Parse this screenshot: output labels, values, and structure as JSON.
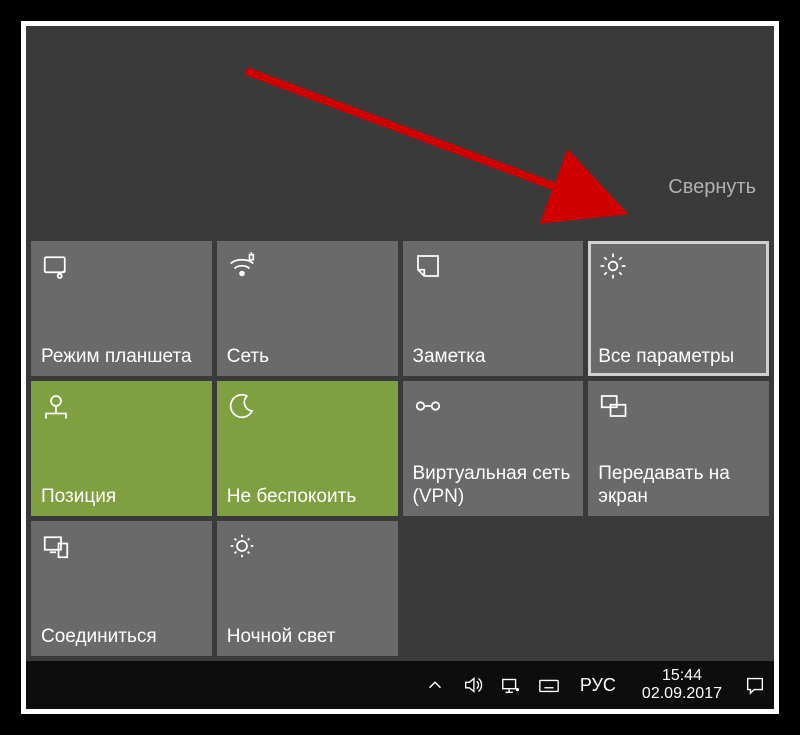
{
  "collapse_label": "Свернуть",
  "tiles": [
    {
      "id": "tablet-mode",
      "label": "Режим планшета",
      "icon": "tablet",
      "active": false,
      "highlight": false
    },
    {
      "id": "network",
      "label": "Сеть",
      "icon": "wifi",
      "active": false,
      "highlight": false
    },
    {
      "id": "note",
      "label": "Заметка",
      "icon": "note",
      "active": false,
      "highlight": false
    },
    {
      "id": "all-settings",
      "label": "Все параметры",
      "icon": "gear",
      "active": false,
      "highlight": true
    },
    {
      "id": "location",
      "label": "Позиция",
      "icon": "location",
      "active": true,
      "highlight": false
    },
    {
      "id": "quiet-hours",
      "label": "Не беспокоить",
      "icon": "moon",
      "active": true,
      "highlight": false
    },
    {
      "id": "vpn",
      "label": "Виртуальная сеть (VPN)",
      "icon": "vpn",
      "active": false,
      "highlight": false
    },
    {
      "id": "project",
      "label": "Передавать на экран",
      "icon": "project",
      "active": false,
      "highlight": false
    },
    {
      "id": "connect",
      "label": "Соединиться",
      "icon": "connect",
      "active": false,
      "highlight": false
    },
    {
      "id": "night-light",
      "label": "Ночной свет",
      "icon": "night",
      "active": false,
      "highlight": false
    }
  ],
  "taskbar": {
    "language": "РУС",
    "time": "15:44",
    "date": "02.09.2017"
  }
}
